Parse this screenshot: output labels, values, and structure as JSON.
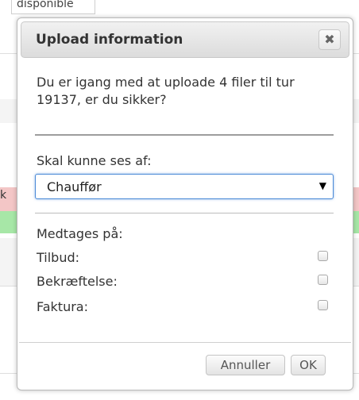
{
  "background": {
    "top_tab_text": "disponible",
    "left_fragment_text": "k"
  },
  "dialog": {
    "title": "Upload information",
    "close_glyph": "✖",
    "message": "Du er igang med at uploade 4 filer til tur 19137, er du sikker?",
    "visibility_label": "Skal kunne ses af:",
    "visibility_selected": "Chauffør",
    "dropdown_glyph": "▼",
    "include_label": "Medtages på:",
    "checkboxes": [
      {
        "label": "Tilbud:",
        "checked": false
      },
      {
        "label": "Bekræftelse:",
        "checked": false
      },
      {
        "label": "Faktura:",
        "checked": false
      }
    ],
    "buttons": {
      "cancel": "Annuller",
      "ok": "OK"
    }
  },
  "colors": {
    "select_focus_border": "#4b8ad7",
    "bg_red_row": "#f3c6c6",
    "bg_green_row": "#a7e7a7"
  }
}
